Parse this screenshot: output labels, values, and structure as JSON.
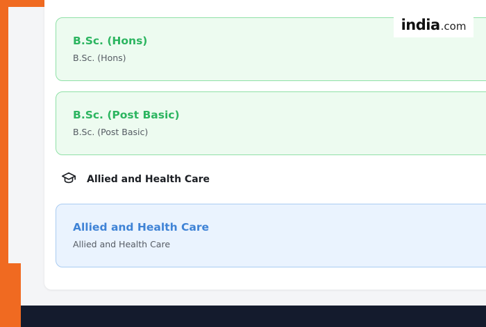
{
  "cards": [
    {
      "title": "B.Sc. (Hons)",
      "subtitle": "B.Sc. (Hons)"
    },
    {
      "title": "B.Sc. (Post Basic)",
      "subtitle": "B.Sc. (Post Basic)"
    },
    {
      "title": "Allied and Health Care",
      "subtitle": "Allied and Health Care"
    }
  ],
  "section": {
    "label": "Allied and Health Care",
    "icon": "graduation-cap-icon"
  },
  "logo": {
    "brand": "india",
    "tld": ".com"
  },
  "colors": {
    "accent_orange": "#f06a21",
    "green_title": "#2cb560",
    "green_card_bg": "#edfbf0",
    "blue_title": "#3f83d6",
    "blue_card_bg": "#eaf3fe",
    "footer": "#141b2d"
  }
}
